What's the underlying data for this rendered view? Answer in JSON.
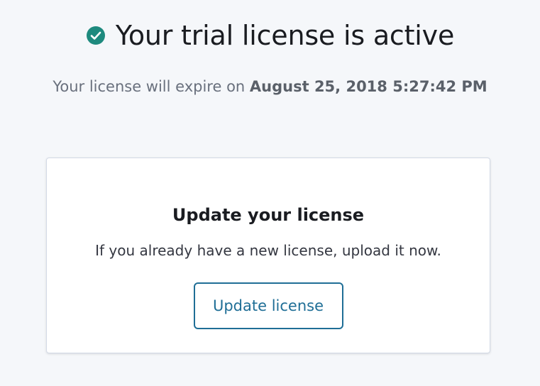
{
  "header": {
    "status_icon": "check-circle-icon",
    "status_color": "#1e8a7e",
    "title": "Your trial license is active"
  },
  "expiry": {
    "prefix": "Your license will expire on ",
    "date": "August 25, 2018 5:27:42 PM"
  },
  "update_panel": {
    "title": "Update your license",
    "description": "If you already have a new license, upload it now.",
    "button_label": "Update license",
    "accent_color": "#1f6e96"
  }
}
